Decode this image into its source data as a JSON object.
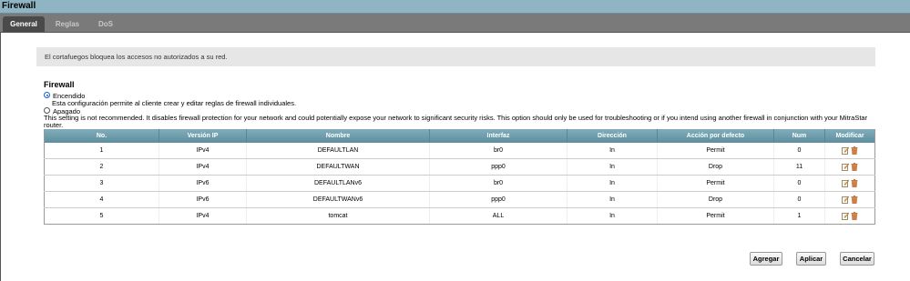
{
  "window": {
    "title": "Firewall"
  },
  "tabs": [
    {
      "label": "General",
      "active": true
    },
    {
      "label": "Reglas",
      "active": false
    },
    {
      "label": "DoS",
      "active": false
    }
  ],
  "info_text": "El cortafuegos bloquea los accesos no autorizados a su red.",
  "section_title": "Firewall",
  "options": [
    {
      "label": "Encendido",
      "selected": true,
      "description": "Esta configuración permite al cliente crear y editar reglas de firewall individuales."
    },
    {
      "label": "Apagado",
      "selected": false,
      "description": "This setting is not recommended. It disables firewall protection for your network and could potentially expose your network to significant security risks. This option should only be used for troubleshooting or if you intend using another firewall in conjunction with your MitraStar router."
    }
  ],
  "table": {
    "headers": [
      "No.",
      "Versión IP",
      "Nombre",
      "Interfaz",
      "Dirección",
      "Acción por defecto",
      "Num",
      "Modificar"
    ],
    "rows": [
      [
        "1",
        "IPv4",
        "DEFAULTLAN",
        "br0",
        "In",
        "Permit",
        "0"
      ],
      [
        "2",
        "IPv4",
        "DEFAULTWAN",
        "ppp0",
        "In",
        "Drop",
        "11"
      ],
      [
        "3",
        "IPv6",
        "DEFAULTLANv6",
        "br0",
        "In",
        "Permit",
        "0"
      ],
      [
        "4",
        "IPv6",
        "DEFAULTWANv6",
        "ppp0",
        "In",
        "Drop",
        "0"
      ],
      [
        "5",
        "IPv4",
        "tomcat",
        "ALL",
        "In",
        "Permit",
        "1"
      ]
    ]
  },
  "buttons": {
    "add": "Agregar",
    "apply": "Aplicar",
    "cancel": "Cancelar"
  },
  "colors": {
    "header_bg": "#6d9cab",
    "title_bg": "#8fb4c4",
    "tab_bar": "#7a7a7a"
  },
  "icons": {
    "edit": "edit-icon",
    "delete": "trash-icon"
  }
}
